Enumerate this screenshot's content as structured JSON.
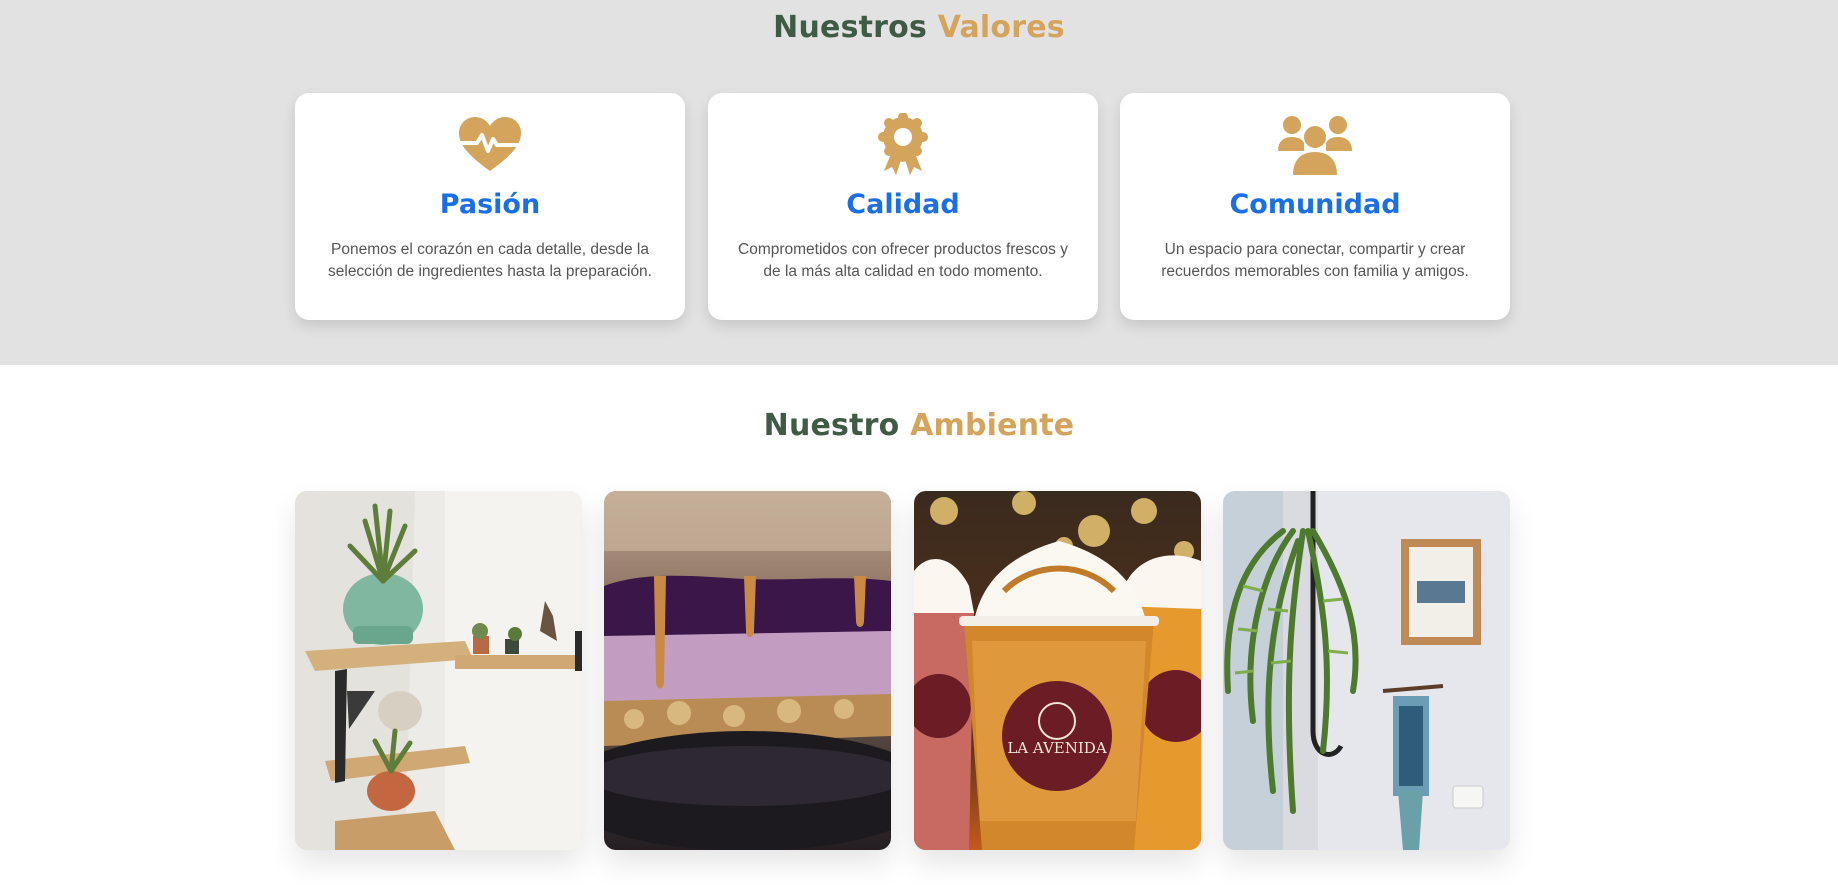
{
  "valores": {
    "title_part1": "Nuestros",
    "title_part2": "Valores",
    "cards": [
      {
        "icon": "heartbeat-icon",
        "title": "Pasión",
        "text": "Ponemos el corazón en cada detalle, desde la selección de ingredientes hasta la preparación."
      },
      {
        "icon": "award-ribbon-icon",
        "title": "Calidad",
        "text": "Comprometidos con ofrecer productos frescos y de la más alta calidad en todo momento."
      },
      {
        "icon": "users-group-icon",
        "title": "Comunidad",
        "text": "Un espacio para conectar, compartir y crear recuerdos memorables con familia y amigos."
      }
    ]
  },
  "ambiente": {
    "title_part1": "Nuestro",
    "title_part2": "Ambiente",
    "photos": [
      {
        "subject": "shelves-with-plants"
      },
      {
        "subject": "blueberry-cheesecake"
      },
      {
        "subject": "frappe-drinks",
        "brand_text": "LA AVENIDA"
      },
      {
        "subject": "hanging-fern-and-wall-art"
      }
    ]
  },
  "colors": {
    "title_dark": "#3f5a45",
    "title_accent": "#d4a45c",
    "card_title": "#1a6fe6",
    "section_bg": "#e2e2e2"
  }
}
